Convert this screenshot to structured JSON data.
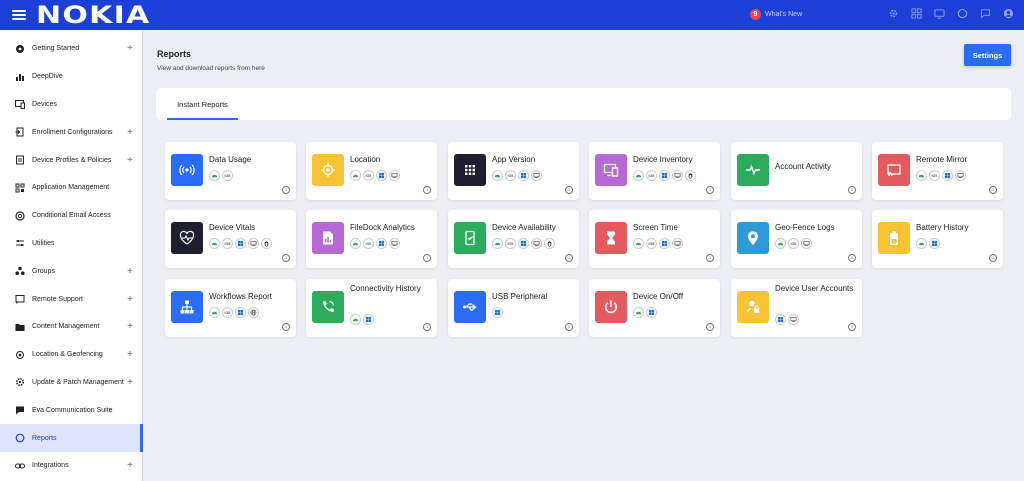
{
  "app": {
    "logo": "NOKIA",
    "whats_new": {
      "count": "9",
      "label": "What's New"
    }
  },
  "top_icons": [
    "settings-icon",
    "grid-icon",
    "monitor-icon",
    "help-icon",
    "chat-icon",
    "user-icon"
  ],
  "sidebar": {
    "items": [
      {
        "label": "Getting Started",
        "icon": "rocket-icon",
        "expandable": true
      },
      {
        "label": "DeepDive",
        "icon": "bar-chart-icon",
        "expandable": false
      },
      {
        "label": "Devices",
        "icon": "devices-icon",
        "expandable": false
      },
      {
        "label": "Enrollment Configurations",
        "icon": "enroll-icon",
        "expandable": true
      },
      {
        "label": "Device Profiles & Policies",
        "icon": "profile-icon",
        "expandable": true
      },
      {
        "label": "Application Management",
        "icon": "apps-icon",
        "expandable": false
      },
      {
        "label": "Conditional Email Access",
        "icon": "at-icon",
        "expandable": false
      },
      {
        "label": "Utilities",
        "icon": "sliders-icon",
        "expandable": false
      },
      {
        "label": "Groups",
        "icon": "groups-icon",
        "expandable": true
      },
      {
        "label": "Remote Support",
        "icon": "cast-icon",
        "expandable": true
      },
      {
        "label": "Content Management",
        "icon": "folder-icon",
        "expandable": true
      },
      {
        "label": "Location & Geofencing",
        "icon": "location-icon",
        "expandable": true
      },
      {
        "label": "Update & Patch Management",
        "icon": "gear-icon",
        "expandable": true
      },
      {
        "label": "Eva Communication Suite",
        "icon": "chat-bubble-icon",
        "expandable": false
      },
      {
        "label": "Reports",
        "icon": "reports-icon",
        "expandable": false,
        "active": true
      },
      {
        "label": "Integrations",
        "icon": "link-icon",
        "expandable": true
      }
    ],
    "plus": "+"
  },
  "main": {
    "title": "Reports",
    "subtitle": "View and download reports from here",
    "settings_label": "Settings",
    "tabs": [
      {
        "label": "Instant Reports",
        "active": true
      }
    ],
    "info_glyph": "i",
    "ios_label": "iOS",
    "cards": [
      {
        "title": "Data Usage",
        "icon": "wireless-icon",
        "color": "#2a6df4",
        "platforms": [
          "android",
          "ios"
        ]
      },
      {
        "title": "Location",
        "icon": "target-icon",
        "color": "#f7c234",
        "platforms": [
          "android",
          "ios",
          "windows",
          "macos"
        ]
      },
      {
        "title": "App Version",
        "icon": "app-grid-icon",
        "color": "#1e1e2e",
        "platforms": [
          "android",
          "ios",
          "windows",
          "macos"
        ]
      },
      {
        "title": "Device Inventory",
        "icon": "inventory-icon",
        "color": "#b668d4",
        "platforms": [
          "android",
          "ios",
          "windows",
          "macos",
          "linux"
        ]
      },
      {
        "title": "Account Activity",
        "icon": "activity-icon",
        "color": "#2bab5b",
        "platforms": []
      },
      {
        "title": "Remote Mirror",
        "icon": "mirror-icon",
        "color": "#e45a5f",
        "platforms": [
          "android",
          "ios",
          "windows",
          "macos"
        ]
      },
      {
        "title": "Device Vitals",
        "icon": "heart-pulse-icon",
        "color": "#1e1e2e",
        "platforms": [
          "android",
          "ios",
          "windows",
          "macos",
          "linux"
        ]
      },
      {
        "title": "FileDock Analytics",
        "icon": "file-chart-icon",
        "color": "#b668d4",
        "platforms": [
          "android",
          "ios",
          "windows",
          "macos"
        ]
      },
      {
        "title": "Device Availability",
        "icon": "phone-check-icon",
        "color": "#2bab5b",
        "platforms": [
          "android",
          "ios",
          "windows",
          "macos",
          "linux"
        ]
      },
      {
        "title": "Screen Time",
        "icon": "hourglass-icon",
        "color": "#e45a5f",
        "platforms": [
          "android",
          "ios",
          "windows",
          "macos"
        ]
      },
      {
        "title": "Geo-Fence Logs",
        "icon": "geo-pin-icon",
        "color": "#2f9bd6",
        "platforms": [
          "android",
          "ios",
          "macos"
        ]
      },
      {
        "title": "Battery History",
        "icon": "battery-icon",
        "color": "#f7c234",
        "platforms": [
          "android",
          "windows"
        ]
      },
      {
        "title": "Workflows Report",
        "icon": "workflow-icon",
        "color": "#2a6df4",
        "platforms": [
          "android",
          "ios",
          "windows",
          "web"
        ]
      },
      {
        "title": "Connectivity History",
        "icon": "call-icon",
        "color": "#2bab5b",
        "platforms": [
          "android",
          "windows"
        ]
      },
      {
        "title": "USB Peripheral",
        "icon": "usb-icon",
        "color": "#2a6df4",
        "platforms": [
          "windows"
        ]
      },
      {
        "title": "Device On/Off",
        "icon": "power-icon",
        "color": "#e45a5f",
        "platforms": [
          "android",
          "windows"
        ]
      },
      {
        "title": "Device User Accounts",
        "icon": "user-lock-icon",
        "color": "#f7c234",
        "platforms": [
          "windows",
          "macos"
        ]
      }
    ]
  }
}
